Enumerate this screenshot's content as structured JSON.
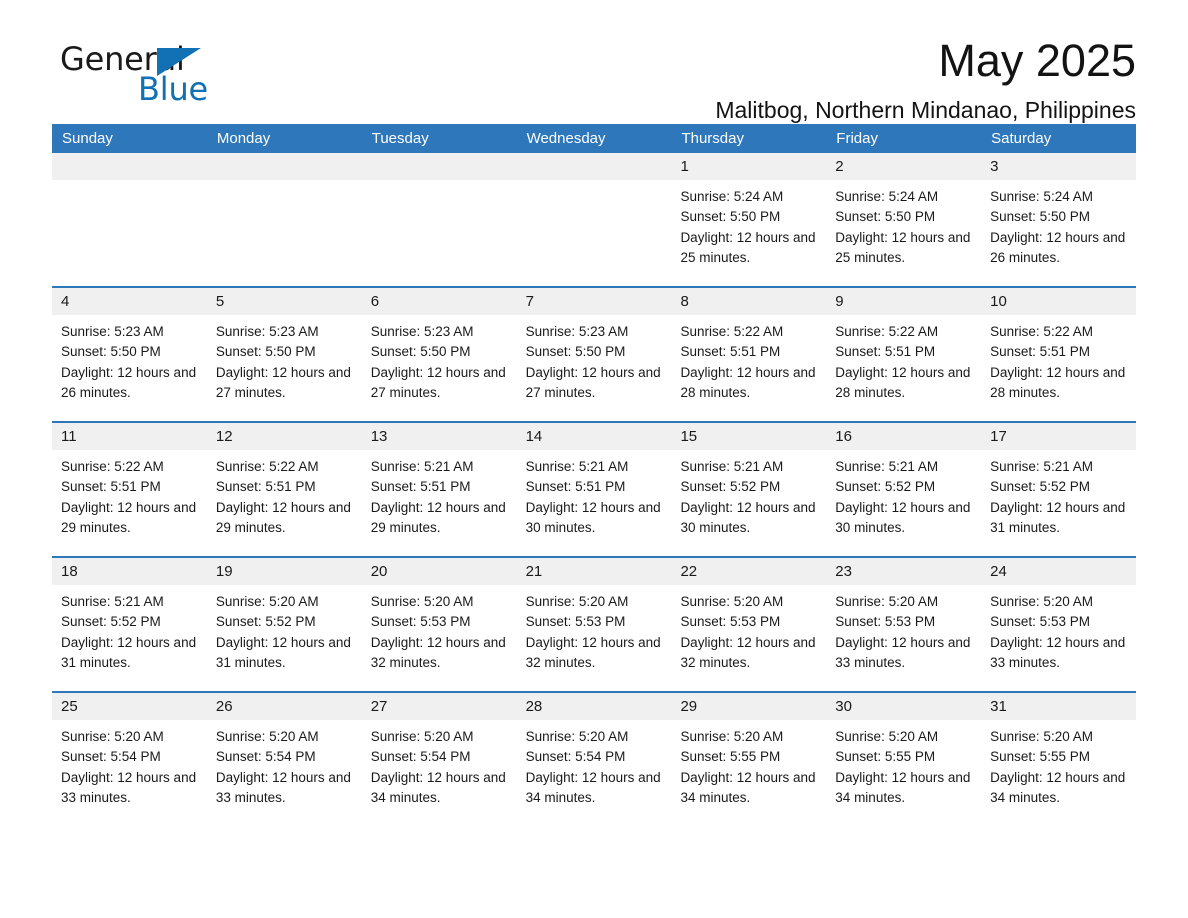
{
  "logo": {
    "word_one": "General",
    "word_two": "Blue",
    "triangle_icon": "triangle-icon",
    "brand_color": "#1271b5"
  },
  "header": {
    "month_title": "May 2025",
    "location": "Malitbog, Northern Mindanao, Philippines"
  },
  "theme": {
    "header_blue": "#2e77bb",
    "day_band_gray": "#f0f0f0",
    "text_dark": "#1a1a1a"
  },
  "calendar": {
    "weekdays": [
      "Sunday",
      "Monday",
      "Tuesday",
      "Wednesday",
      "Thursday",
      "Friday",
      "Saturday"
    ],
    "weeks": [
      [
        {
          "day": "",
          "sunrise": "",
          "sunset": "",
          "daylight": "",
          "empty": true
        },
        {
          "day": "",
          "sunrise": "",
          "sunset": "",
          "daylight": "",
          "empty": true
        },
        {
          "day": "",
          "sunrise": "",
          "sunset": "",
          "daylight": "",
          "empty": true
        },
        {
          "day": "",
          "sunrise": "",
          "sunset": "",
          "daylight": "",
          "empty": true
        },
        {
          "day": "1",
          "sunrise": "Sunrise: 5:24 AM",
          "sunset": "Sunset: 5:50 PM",
          "daylight": "Daylight: 12 hours and 25 minutes."
        },
        {
          "day": "2",
          "sunrise": "Sunrise: 5:24 AM",
          "sunset": "Sunset: 5:50 PM",
          "daylight": "Daylight: 12 hours and 25 minutes."
        },
        {
          "day": "3",
          "sunrise": "Sunrise: 5:24 AM",
          "sunset": "Sunset: 5:50 PM",
          "daylight": "Daylight: 12 hours and 26 minutes."
        }
      ],
      [
        {
          "day": "4",
          "sunrise": "Sunrise: 5:23 AM",
          "sunset": "Sunset: 5:50 PM",
          "daylight": "Daylight: 12 hours and 26 minutes."
        },
        {
          "day": "5",
          "sunrise": "Sunrise: 5:23 AM",
          "sunset": "Sunset: 5:50 PM",
          "daylight": "Daylight: 12 hours and 27 minutes."
        },
        {
          "day": "6",
          "sunrise": "Sunrise: 5:23 AM",
          "sunset": "Sunset: 5:50 PM",
          "daylight": "Daylight: 12 hours and 27 minutes."
        },
        {
          "day": "7",
          "sunrise": "Sunrise: 5:23 AM",
          "sunset": "Sunset: 5:50 PM",
          "daylight": "Daylight: 12 hours and 27 minutes."
        },
        {
          "day": "8",
          "sunrise": "Sunrise: 5:22 AM",
          "sunset": "Sunset: 5:51 PM",
          "daylight": "Daylight: 12 hours and 28 minutes."
        },
        {
          "day": "9",
          "sunrise": "Sunrise: 5:22 AM",
          "sunset": "Sunset: 5:51 PM",
          "daylight": "Daylight: 12 hours and 28 minutes."
        },
        {
          "day": "10",
          "sunrise": "Sunrise: 5:22 AM",
          "sunset": "Sunset: 5:51 PM",
          "daylight": "Daylight: 12 hours and 28 minutes."
        }
      ],
      [
        {
          "day": "11",
          "sunrise": "Sunrise: 5:22 AM",
          "sunset": "Sunset: 5:51 PM",
          "daylight": "Daylight: 12 hours and 29 minutes."
        },
        {
          "day": "12",
          "sunrise": "Sunrise: 5:22 AM",
          "sunset": "Sunset: 5:51 PM",
          "daylight": "Daylight: 12 hours and 29 minutes."
        },
        {
          "day": "13",
          "sunrise": "Sunrise: 5:21 AM",
          "sunset": "Sunset: 5:51 PM",
          "daylight": "Daylight: 12 hours and 29 minutes."
        },
        {
          "day": "14",
          "sunrise": "Sunrise: 5:21 AM",
          "sunset": "Sunset: 5:51 PM",
          "daylight": "Daylight: 12 hours and 30 minutes."
        },
        {
          "day": "15",
          "sunrise": "Sunrise: 5:21 AM",
          "sunset": "Sunset: 5:52 PM",
          "daylight": "Daylight: 12 hours and 30 minutes."
        },
        {
          "day": "16",
          "sunrise": "Sunrise: 5:21 AM",
          "sunset": "Sunset: 5:52 PM",
          "daylight": "Daylight: 12 hours and 30 minutes."
        },
        {
          "day": "17",
          "sunrise": "Sunrise: 5:21 AM",
          "sunset": "Sunset: 5:52 PM",
          "daylight": "Daylight: 12 hours and 31 minutes."
        }
      ],
      [
        {
          "day": "18",
          "sunrise": "Sunrise: 5:21 AM",
          "sunset": "Sunset: 5:52 PM",
          "daylight": "Daylight: 12 hours and 31 minutes."
        },
        {
          "day": "19",
          "sunrise": "Sunrise: 5:20 AM",
          "sunset": "Sunset: 5:52 PM",
          "daylight": "Daylight: 12 hours and 31 minutes."
        },
        {
          "day": "20",
          "sunrise": "Sunrise: 5:20 AM",
          "sunset": "Sunset: 5:53 PM",
          "daylight": "Daylight: 12 hours and 32 minutes."
        },
        {
          "day": "21",
          "sunrise": "Sunrise: 5:20 AM",
          "sunset": "Sunset: 5:53 PM",
          "daylight": "Daylight: 12 hours and 32 minutes."
        },
        {
          "day": "22",
          "sunrise": "Sunrise: 5:20 AM",
          "sunset": "Sunset: 5:53 PM",
          "daylight": "Daylight: 12 hours and 32 minutes."
        },
        {
          "day": "23",
          "sunrise": "Sunrise: 5:20 AM",
          "sunset": "Sunset: 5:53 PM",
          "daylight": "Daylight: 12 hours and 33 minutes."
        },
        {
          "day": "24",
          "sunrise": "Sunrise: 5:20 AM",
          "sunset": "Sunset: 5:53 PM",
          "daylight": "Daylight: 12 hours and 33 minutes."
        }
      ],
      [
        {
          "day": "25",
          "sunrise": "Sunrise: 5:20 AM",
          "sunset": "Sunset: 5:54 PM",
          "daylight": "Daylight: 12 hours and 33 minutes."
        },
        {
          "day": "26",
          "sunrise": "Sunrise: 5:20 AM",
          "sunset": "Sunset: 5:54 PM",
          "daylight": "Daylight: 12 hours and 33 minutes."
        },
        {
          "day": "27",
          "sunrise": "Sunrise: 5:20 AM",
          "sunset": "Sunset: 5:54 PM",
          "daylight": "Daylight: 12 hours and 34 minutes."
        },
        {
          "day": "28",
          "sunrise": "Sunrise: 5:20 AM",
          "sunset": "Sunset: 5:54 PM",
          "daylight": "Daylight: 12 hours and 34 minutes."
        },
        {
          "day": "29",
          "sunrise": "Sunrise: 5:20 AM",
          "sunset": "Sunset: 5:55 PM",
          "daylight": "Daylight: 12 hours and 34 minutes."
        },
        {
          "day": "30",
          "sunrise": "Sunrise: 5:20 AM",
          "sunset": "Sunset: 5:55 PM",
          "daylight": "Daylight: 12 hours and 34 minutes."
        },
        {
          "day": "31",
          "sunrise": "Sunrise: 5:20 AM",
          "sunset": "Sunset: 5:55 PM",
          "daylight": "Daylight: 12 hours and 34 minutes."
        }
      ]
    ]
  }
}
